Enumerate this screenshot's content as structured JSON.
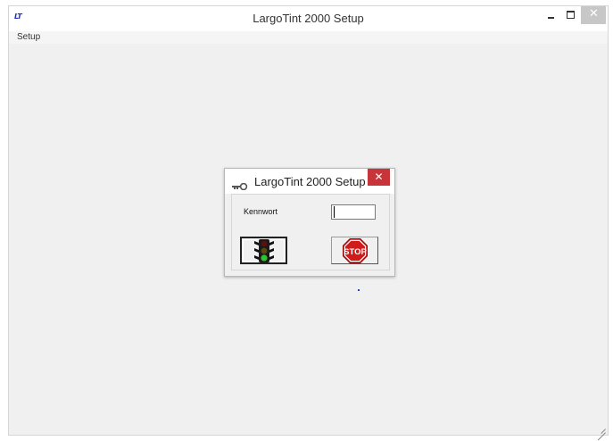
{
  "window": {
    "title": "LargoTint 2000 Setup",
    "logo_text": "LT",
    "menu": [
      {
        "label": "Setup"
      }
    ]
  },
  "dialog": {
    "title": "LargoTint 2000 Setup",
    "password_label": "Kennwort",
    "password_value": "",
    "stop_button_text": "STOP"
  },
  "colors": {
    "logo": "#1d2fd6",
    "close_button_active": "#c7353a",
    "stop_sign": "#d11a1a",
    "traffic_light_green": "#2ec42e"
  },
  "icons": {
    "app": "lt-logo-icon",
    "dialog": "key-icon",
    "ok_button": "traffic-light-icon",
    "cancel_button": "stop-sign-icon"
  }
}
